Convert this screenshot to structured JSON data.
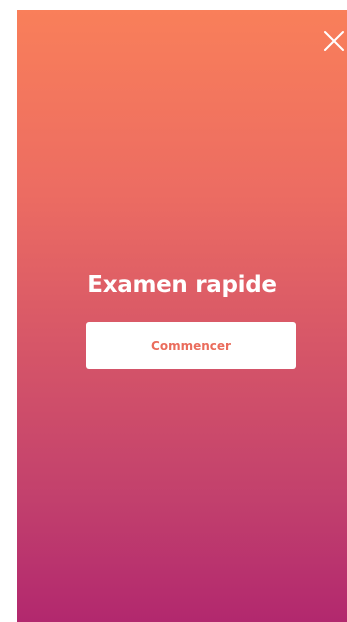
{
  "screen": {
    "title": "Examen rapide",
    "start_label": "Commencer"
  },
  "icons": {
    "close": "close-icon"
  },
  "colors": {
    "gradient_top": "#f97f5a",
    "gradient_bottom": "#b2286e",
    "button_text": "#ea6c5c",
    "title_text": "#ffffff"
  }
}
